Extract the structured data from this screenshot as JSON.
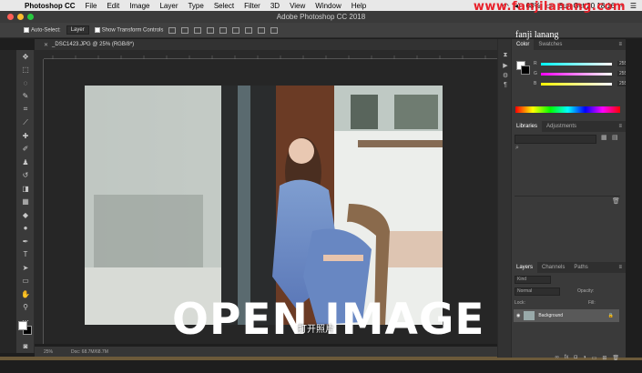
{
  "menubar": {
    "app_name": "Photoshop CC",
    "items": [
      "File",
      "Edit",
      "Image",
      "Layer",
      "Type",
      "Select",
      "Filter",
      "3D",
      "View",
      "Window",
      "Help"
    ],
    "battery": "68%",
    "date_time": "Sun Oct 20  18:16"
  },
  "window": {
    "title": "Adobe Photoshop CC 2018",
    "watermark": "www.fanjilanang.com"
  },
  "options": {
    "auto_select_label": "Auto-Select:",
    "auto_select_value": "Layer",
    "transform_label": "Show Transform Controls"
  },
  "document": {
    "tab_title": "_DSC1423.JPG @ 25% (RGB/8*)",
    "zoom": "25%",
    "doc_size": "Doc: 68.7M/68.7M"
  },
  "overlay": {
    "headline": "OPEN IMAGE",
    "subtitle": "打开照片",
    "signature": "fanji lanang"
  },
  "color_panel": {
    "tabs": [
      "Color",
      "Swatches"
    ],
    "r_label": "R",
    "r_value": "255",
    "g_label": "G",
    "g_value": "255",
    "b_label": "B",
    "b_value": "255"
  },
  "libraries_panel": {
    "tabs": [
      "Libraries",
      "Adjustments"
    ]
  },
  "layers_panel": {
    "tabs": [
      "Layers",
      "Channels",
      "Paths"
    ],
    "kind_label": "Kind",
    "blend_mode": "Normal",
    "opacity_label": "Opacity:",
    "lock_label": "Lock:",
    "fill_label": "Fill:",
    "layer_name": "Background"
  },
  "colors": {
    "menubar_bg": "#e8e8e8",
    "ps_dark": "#3a3a3a",
    "accent_blue": "#4a90d9",
    "watermark_red": "#e8202a"
  }
}
